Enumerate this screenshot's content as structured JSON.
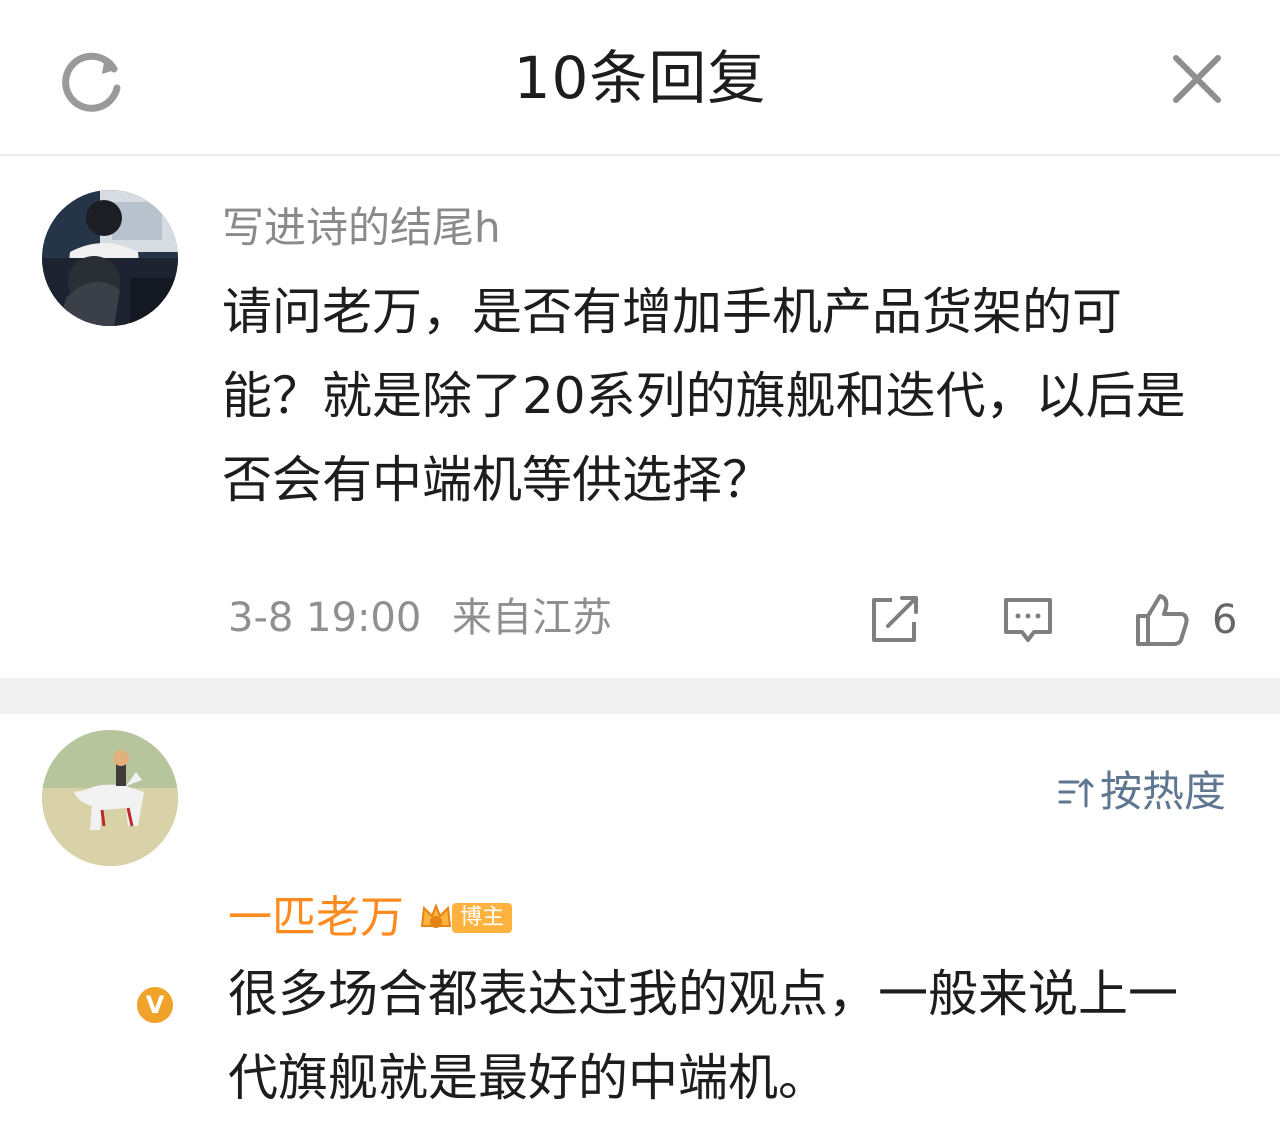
{
  "header": {
    "title": "10条回复",
    "left_icon": "refresh-icon",
    "right_icon": "close-icon"
  },
  "root_comment": {
    "username": "写进诗的结尾h",
    "content": "请问老万，是否有增加手机产品货架的可能？就是除了20系列的旗舰和迭代，以后是否会有中端机等供选择？",
    "time": "3-8 19:00",
    "location": "来自江苏",
    "like_count": "6",
    "actions": [
      "share-icon",
      "comment-icon",
      "like-icon"
    ]
  },
  "sort": {
    "label": "按热度",
    "icon": "sort-icon"
  },
  "reply": {
    "username": "一匹老万",
    "badge_text": "博主",
    "content": "很多场合都表达过我的观点，一般来说上一代旗舰就是最好的中端机。",
    "verified_mark": "V"
  },
  "colors": {
    "accent_orange": "#ff8a1f",
    "badge_orange": "#ffb23e",
    "sort_blue": "#5f7690",
    "muted_text": "#8a8a8a",
    "divider": "#f0f0f0"
  }
}
